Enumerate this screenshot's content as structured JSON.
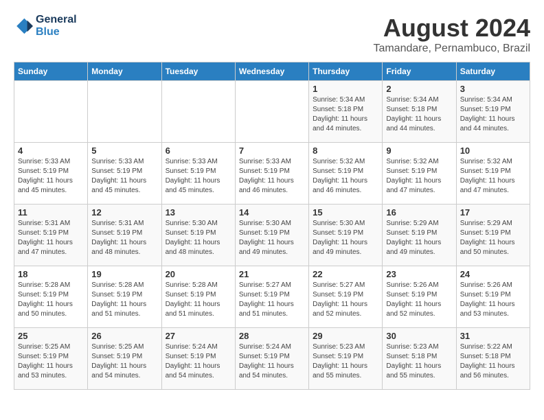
{
  "logo": {
    "line1": "General",
    "line2": "Blue"
  },
  "title": "August 2024",
  "subtitle": "Tamandare, Pernambuco, Brazil",
  "days_of_week": [
    "Sunday",
    "Monday",
    "Tuesday",
    "Wednesday",
    "Thursday",
    "Friday",
    "Saturday"
  ],
  "weeks": [
    [
      {
        "day": "",
        "info": ""
      },
      {
        "day": "",
        "info": ""
      },
      {
        "day": "",
        "info": ""
      },
      {
        "day": "",
        "info": ""
      },
      {
        "day": "1",
        "info": "Sunrise: 5:34 AM\nSunset: 5:18 PM\nDaylight: 11 hours\nand 44 minutes."
      },
      {
        "day": "2",
        "info": "Sunrise: 5:34 AM\nSunset: 5:18 PM\nDaylight: 11 hours\nand 44 minutes."
      },
      {
        "day": "3",
        "info": "Sunrise: 5:34 AM\nSunset: 5:19 PM\nDaylight: 11 hours\nand 44 minutes."
      }
    ],
    [
      {
        "day": "4",
        "info": "Sunrise: 5:33 AM\nSunset: 5:19 PM\nDaylight: 11 hours\nand 45 minutes."
      },
      {
        "day": "5",
        "info": "Sunrise: 5:33 AM\nSunset: 5:19 PM\nDaylight: 11 hours\nand 45 minutes."
      },
      {
        "day": "6",
        "info": "Sunrise: 5:33 AM\nSunset: 5:19 PM\nDaylight: 11 hours\nand 45 minutes."
      },
      {
        "day": "7",
        "info": "Sunrise: 5:33 AM\nSunset: 5:19 PM\nDaylight: 11 hours\nand 46 minutes."
      },
      {
        "day": "8",
        "info": "Sunrise: 5:32 AM\nSunset: 5:19 PM\nDaylight: 11 hours\nand 46 minutes."
      },
      {
        "day": "9",
        "info": "Sunrise: 5:32 AM\nSunset: 5:19 PM\nDaylight: 11 hours\nand 47 minutes."
      },
      {
        "day": "10",
        "info": "Sunrise: 5:32 AM\nSunset: 5:19 PM\nDaylight: 11 hours\nand 47 minutes."
      }
    ],
    [
      {
        "day": "11",
        "info": "Sunrise: 5:31 AM\nSunset: 5:19 PM\nDaylight: 11 hours\nand 47 minutes."
      },
      {
        "day": "12",
        "info": "Sunrise: 5:31 AM\nSunset: 5:19 PM\nDaylight: 11 hours\nand 48 minutes."
      },
      {
        "day": "13",
        "info": "Sunrise: 5:30 AM\nSunset: 5:19 PM\nDaylight: 11 hours\nand 48 minutes."
      },
      {
        "day": "14",
        "info": "Sunrise: 5:30 AM\nSunset: 5:19 PM\nDaylight: 11 hours\nand 49 minutes."
      },
      {
        "day": "15",
        "info": "Sunrise: 5:30 AM\nSunset: 5:19 PM\nDaylight: 11 hours\nand 49 minutes."
      },
      {
        "day": "16",
        "info": "Sunrise: 5:29 AM\nSunset: 5:19 PM\nDaylight: 11 hours\nand 49 minutes."
      },
      {
        "day": "17",
        "info": "Sunrise: 5:29 AM\nSunset: 5:19 PM\nDaylight: 11 hours\nand 50 minutes."
      }
    ],
    [
      {
        "day": "18",
        "info": "Sunrise: 5:28 AM\nSunset: 5:19 PM\nDaylight: 11 hours\nand 50 minutes."
      },
      {
        "day": "19",
        "info": "Sunrise: 5:28 AM\nSunset: 5:19 PM\nDaylight: 11 hours\nand 51 minutes."
      },
      {
        "day": "20",
        "info": "Sunrise: 5:28 AM\nSunset: 5:19 PM\nDaylight: 11 hours\nand 51 minutes."
      },
      {
        "day": "21",
        "info": "Sunrise: 5:27 AM\nSunset: 5:19 PM\nDaylight: 11 hours\nand 51 minutes."
      },
      {
        "day": "22",
        "info": "Sunrise: 5:27 AM\nSunset: 5:19 PM\nDaylight: 11 hours\nand 52 minutes."
      },
      {
        "day": "23",
        "info": "Sunrise: 5:26 AM\nSunset: 5:19 PM\nDaylight: 11 hours\nand 52 minutes."
      },
      {
        "day": "24",
        "info": "Sunrise: 5:26 AM\nSunset: 5:19 PM\nDaylight: 11 hours\nand 53 minutes."
      }
    ],
    [
      {
        "day": "25",
        "info": "Sunrise: 5:25 AM\nSunset: 5:19 PM\nDaylight: 11 hours\nand 53 minutes."
      },
      {
        "day": "26",
        "info": "Sunrise: 5:25 AM\nSunset: 5:19 PM\nDaylight: 11 hours\nand 54 minutes."
      },
      {
        "day": "27",
        "info": "Sunrise: 5:24 AM\nSunset: 5:19 PM\nDaylight: 11 hours\nand 54 minutes."
      },
      {
        "day": "28",
        "info": "Sunrise: 5:24 AM\nSunset: 5:19 PM\nDaylight: 11 hours\nand 54 minutes."
      },
      {
        "day": "29",
        "info": "Sunrise: 5:23 AM\nSunset: 5:19 PM\nDaylight: 11 hours\nand 55 minutes."
      },
      {
        "day": "30",
        "info": "Sunrise: 5:23 AM\nSunset: 5:18 PM\nDaylight: 11 hours\nand 55 minutes."
      },
      {
        "day": "31",
        "info": "Sunrise: 5:22 AM\nSunset: 5:18 PM\nDaylight: 11 hours\nand 56 minutes."
      }
    ]
  ]
}
